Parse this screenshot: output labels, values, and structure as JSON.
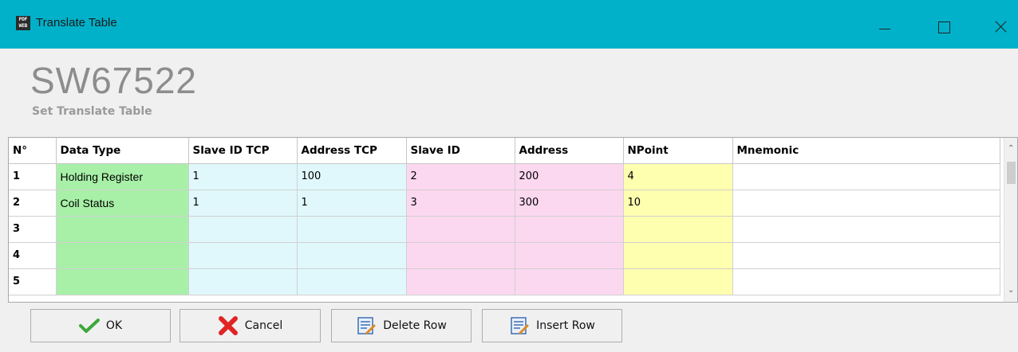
{
  "window": {
    "title": "Translate Table",
    "icon_text": "PDF WEB"
  },
  "header": {
    "product": "SW67522",
    "subtitle": "Set Translate Table"
  },
  "table": {
    "columns": [
      "N°",
      "Data Type",
      "Slave ID TCP",
      "Address TCP",
      "Slave ID",
      "Address",
      "NPoint",
      "Mnemonic"
    ],
    "rows": [
      [
        "1",
        "Holding Register",
        "1",
        "100",
        "2",
        "200",
        "4",
        ""
      ],
      [
        "2",
        "Coil Status",
        "1",
        "1",
        "3",
        "300",
        "10",
        ""
      ],
      [
        "3",
        "",
        "",
        "",
        "",
        "",
        "",
        ""
      ],
      [
        "4",
        "",
        "",
        "",
        "",
        "",
        "",
        ""
      ],
      [
        "5",
        "",
        "",
        "",
        "",
        "",
        "",
        ""
      ]
    ]
  },
  "buttons": {
    "ok": "OK",
    "cancel": "Cancel",
    "delete_row": "Delete Row",
    "insert_row": "Insert Row"
  },
  "colors": {
    "titlebar": "#00b1c9",
    "data_type": "#a8f0a8",
    "tcp": "#e0f8fc",
    "rtu": "#fcd8f0",
    "npoint": "#ffffb0"
  },
  "icons": [
    "app-icon",
    "minimize-icon",
    "maximize-icon",
    "close-icon",
    "checkmark-icon",
    "cross-icon",
    "delete-row-icon",
    "insert-row-icon"
  ]
}
